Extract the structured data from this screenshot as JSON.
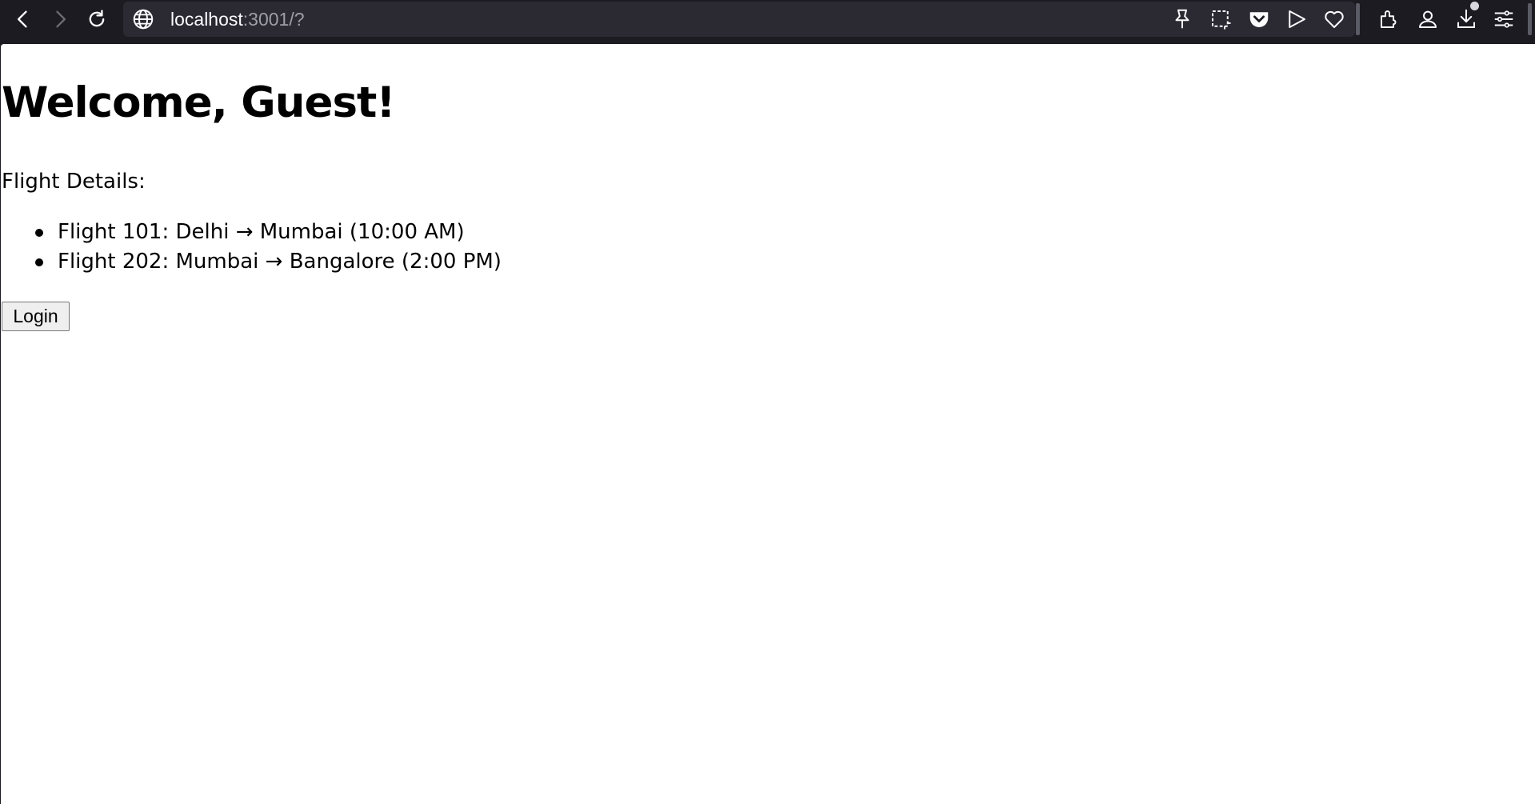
{
  "browser": {
    "url_host": "localhost",
    "url_rest": ":3001/?",
    "toolbar_icons": [
      "back-icon",
      "forward-icon",
      "reload-icon",
      "globe-icon",
      "pin-icon",
      "screenshot-icon",
      "pocket-icon",
      "send-icon",
      "heart-icon",
      "extensions-icon",
      "account-icon",
      "downloads-icon",
      "menu-icon"
    ]
  },
  "page": {
    "title": "Welcome, Guest!",
    "flight_label": "Flight Details:",
    "flights": [
      "Flight 101: Delhi → Mumbai (10:00 AM)",
      "Flight 202: Mumbai → Bangalore (2:00 PM)"
    ],
    "login_label": "Login"
  }
}
